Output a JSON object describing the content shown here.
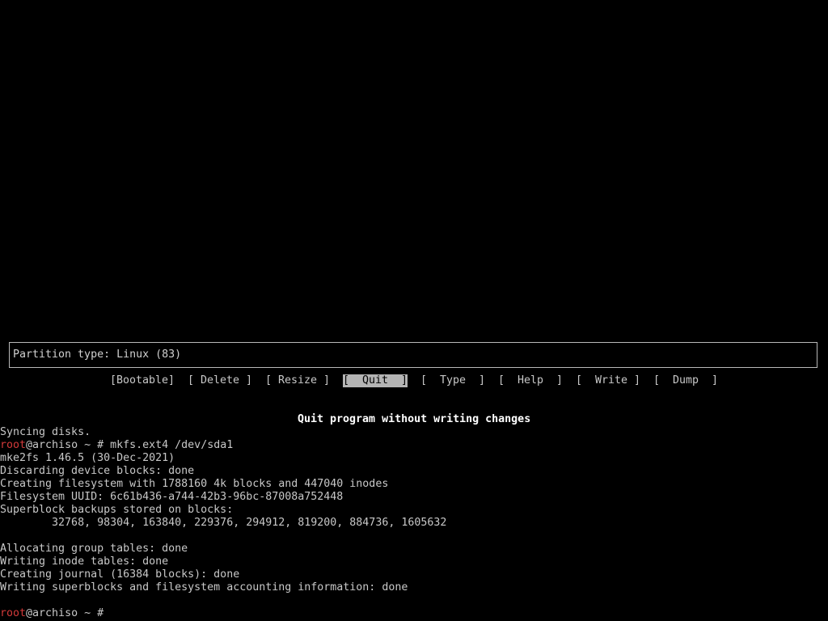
{
  "fdisk": {
    "info_box_text": "Partition type: Linux (83)",
    "menu": [
      {
        "label": "[Bootable]",
        "selected": false
      },
      {
        "label": "[ Delete ]",
        "selected": false
      },
      {
        "label": "[ Resize ]",
        "selected": false
      },
      {
        "label": "[  Quit  ]",
        "selected": true
      },
      {
        "label": "[  Type  ]",
        "selected": false
      },
      {
        "label": "[  Help  ]",
        "selected": false
      },
      {
        "label": "[  Write ]",
        "selected": false
      },
      {
        "label": "[  Dump  ]",
        "selected": false
      }
    ],
    "help_text": "Quit program without writing changes"
  },
  "terminal": {
    "prompt_user": "root",
    "prompt_host": "@archiso ~ #",
    "lines": [
      {
        "text": "Syncing disks."
      },
      {
        "prompt": true,
        "text": " mkfs.ext4 /dev/sda1"
      },
      {
        "text": "mke2fs 1.46.5 (30-Dec-2021)"
      },
      {
        "text": "Discarding device blocks: done"
      },
      {
        "text": "Creating filesystem with 1788160 4k blocks and 447040 inodes"
      },
      {
        "text": "Filesystem UUID: 6c61b436-a744-42b3-96bc-87008a752448"
      },
      {
        "text": "Superblock backups stored on blocks:"
      },
      {
        "text": "        32768, 98304, 163840, 229376, 294912, 819200, 884736, 1605632"
      },
      {
        "text": ""
      },
      {
        "text": "Allocating group tables: done"
      },
      {
        "text": "Writing inode tables: done"
      },
      {
        "text": "Creating journal (16384 blocks): done"
      },
      {
        "text": "Writing superblocks and filesystem accounting information: done"
      },
      {
        "text": ""
      },
      {
        "prompt": true,
        "text": ""
      }
    ]
  },
  "colors": {
    "background": "#000000",
    "text": "#c8c8c8",
    "prompt_user": "#d23a3a",
    "selected_bg": "#b4b4b4"
  }
}
